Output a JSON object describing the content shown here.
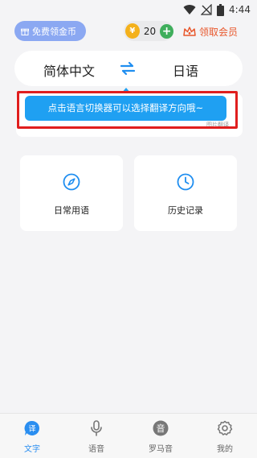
{
  "status_bar": {
    "time": "4:44",
    "icons": [
      "wifi-icon",
      "signal-off-icon",
      "battery-icon"
    ]
  },
  "header": {
    "free_coin_label": "免费领金币",
    "coin_count": "20",
    "coin_symbol": "¥",
    "add_coin_symbol": "+",
    "vip_label": "领取会员"
  },
  "language": {
    "source": "简体中文",
    "target": "日语"
  },
  "input": {
    "hint": "图片翻译"
  },
  "tooltip": {
    "text": "点击语言切换器可以选择翻译方向哦~"
  },
  "features": [
    {
      "label": "日常用语",
      "icon": "compass-icon"
    },
    {
      "label": "历史记录",
      "icon": "clock-icon"
    }
  ],
  "tabs": [
    {
      "label": "文字",
      "icon": "translate-icon",
      "active": true
    },
    {
      "label": "语音",
      "icon": "microphone-icon",
      "active": false
    },
    {
      "label": "罗马音",
      "icon": "romaji-icon",
      "active": false
    },
    {
      "label": "我的",
      "icon": "settings-icon",
      "active": false
    }
  ],
  "colors": {
    "accent": "#1fa0f2",
    "highlight_border": "#e01e1e",
    "vip": "#e8572c",
    "coin": "#f4b11c",
    "add_coin": "#3fae5c",
    "free_coin_bg": "#8ba8f2"
  }
}
